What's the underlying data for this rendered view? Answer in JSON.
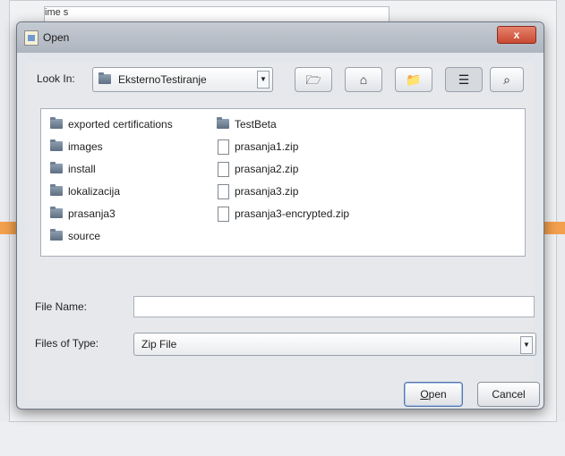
{
  "background": {
    "label": "ime s",
    "accent_color": "#f2a04e"
  },
  "dialog": {
    "title": "Open",
    "close_label": "x"
  },
  "look_in": {
    "label": "Look In:",
    "value": "EksternoTestiranje",
    "toolbar_icons": [
      "up-folder-icon",
      "home-icon",
      "new-folder-icon",
      "list-view-icon",
      "details-view-icon"
    ]
  },
  "files": [
    {
      "name": "exported certifications",
      "kind": "folder"
    },
    {
      "name": "images",
      "kind": "folder"
    },
    {
      "name": "install",
      "kind": "folder"
    },
    {
      "name": "lokalizacija",
      "kind": "folder"
    },
    {
      "name": "prasanja3",
      "kind": "folder"
    },
    {
      "name": "source",
      "kind": "folder"
    },
    {
      "name": "TestBeta",
      "kind": "folder"
    },
    {
      "name": "prasanja1.zip",
      "kind": "file"
    },
    {
      "name": "prasanja2.zip",
      "kind": "file"
    },
    {
      "name": "prasanja3.zip",
      "kind": "file"
    },
    {
      "name": "prasanja3-encrypted.zip",
      "kind": "file"
    }
  ],
  "file_name": {
    "label": "File Name:",
    "value": ""
  },
  "files_of_type": {
    "label": "Files of Type:",
    "value": "Zip File"
  },
  "buttons": {
    "open_underlined": "O",
    "open_rest": "pen",
    "cancel": "Cancel"
  }
}
